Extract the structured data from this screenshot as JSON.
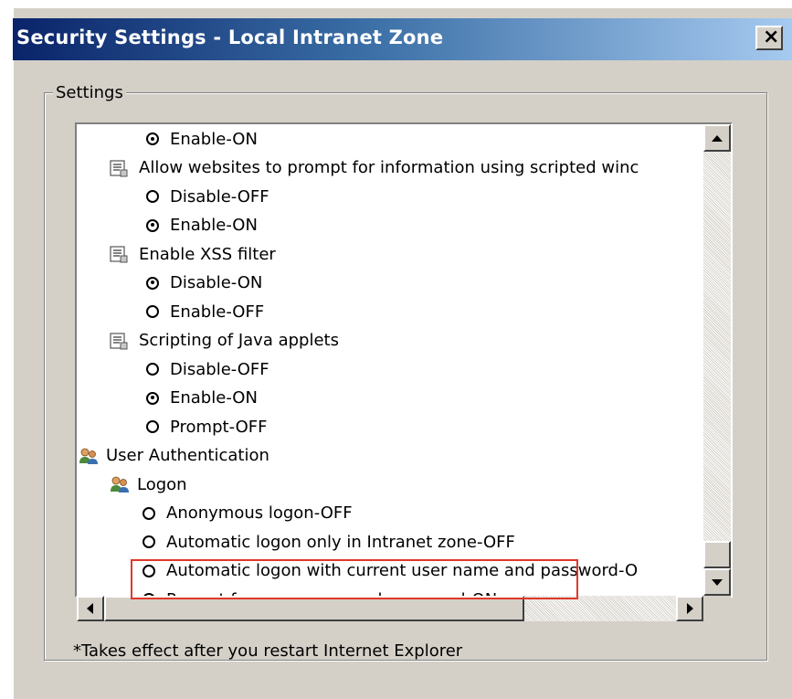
{
  "window": {
    "title": "Security Settings - Local Intranet Zone",
    "close_glyph": "×"
  },
  "settings": {
    "group_label": "Settings",
    "items": [
      {
        "kind": "radio",
        "label": "Enable-ON",
        "checked": true,
        "indent": 1
      },
      {
        "kind": "category",
        "label": "Allow websites to prompt for information using scripted winc",
        "icon": "script-settings-icon"
      },
      {
        "kind": "radio",
        "label": "Disable-OFF",
        "checked": false,
        "indent": 1
      },
      {
        "kind": "radio",
        "label": "Enable-ON",
        "checked": true,
        "indent": 1
      },
      {
        "kind": "category",
        "label": "Enable XSS filter",
        "icon": "script-settings-icon"
      },
      {
        "kind": "radio",
        "label": "Disable-ON",
        "checked": true,
        "indent": 1
      },
      {
        "kind": "radio",
        "label": "Enable-OFF",
        "checked": false,
        "indent": 1
      },
      {
        "kind": "category",
        "label": "Scripting of Java applets",
        "icon": "script-settings-icon"
      },
      {
        "kind": "radio",
        "label": "Disable-OFF",
        "checked": false,
        "indent": 1
      },
      {
        "kind": "radio",
        "label": "Enable-ON",
        "checked": true,
        "indent": 1
      },
      {
        "kind": "radio",
        "label": "Prompt-OFF",
        "checked": false,
        "indent": 1
      },
      {
        "kind": "section",
        "label": "User Authentication",
        "icon": "users-icon"
      },
      {
        "kind": "subsection",
        "label": "Logon",
        "icon": "users-icon"
      },
      {
        "kind": "radio",
        "label": "Anonymous logon-OFF",
        "checked": false,
        "indent": 2
      },
      {
        "kind": "radio",
        "label": "Automatic logon only in Intranet zone-OFF",
        "checked": false,
        "indent": 2
      },
      {
        "kind": "radio",
        "label": "Automatic logon with current user name and password-O",
        "checked": false,
        "indent": 2
      },
      {
        "kind": "radio",
        "label": "Prompt for user name and password-ON",
        "checked": true,
        "indent": 2,
        "highlighted": true
      }
    ]
  },
  "footnote": "*Takes effect after you restart Internet Explorer",
  "colors": {
    "highlight": "#e0372b",
    "dialog_bg": "#d4d0c8",
    "title_start": "#0a246a"
  }
}
